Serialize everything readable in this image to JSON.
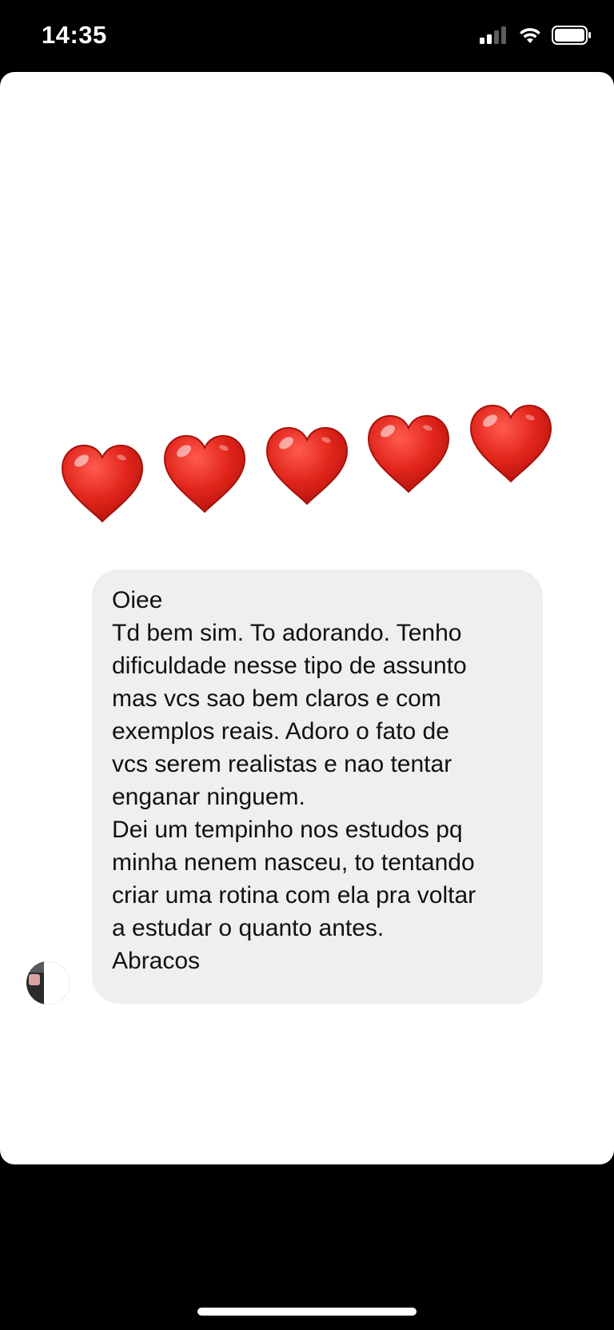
{
  "status_bar": {
    "time": "14:35",
    "signal_icon": "cellular-signal-icon",
    "wifi_icon": "wifi-icon",
    "battery_icon": "battery-icon"
  },
  "reactions": {
    "emoji": "red-heart",
    "count": 5,
    "color": "#e1251b"
  },
  "message": {
    "lines": [
      "Oiee",
      "Td bem sim. To adorando. Tenho\ndificuldade nesse tipo de assunto\nmas vcs sao bem claros e com\nexemplos reais. Adoro o fato de\nvcs serem realistas e nao tentar\nenganar ninguem.",
      "Dei um tempinho nos estudos pq\nminha nenem nasceu, to tentando\ncriar uma rotina com ela pra voltar\na estudar o quanto antes.",
      "Abracos"
    ],
    "bubble_color": "#efefef"
  }
}
